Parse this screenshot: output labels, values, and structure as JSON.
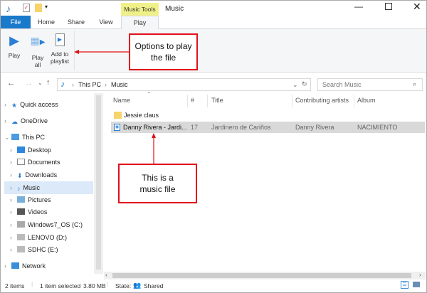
{
  "window": {
    "title": "Music",
    "context_tab_group": "Music Tools"
  },
  "tabs": [
    {
      "label": "File"
    },
    {
      "label": "Home"
    },
    {
      "label": "Share"
    },
    {
      "label": "View"
    },
    {
      "label": "Play"
    }
  ],
  "ribbon": {
    "play": "Play",
    "play_all_1": "Play",
    "play_all_2": "all",
    "add_1": "Add to",
    "add_2": "playlist"
  },
  "address": {
    "crumbs": [
      "This PC",
      "Music"
    ],
    "search_placeholder": "Search Music"
  },
  "columns": [
    "Name",
    "#",
    "Title",
    "Contributing artists",
    "Album"
  ],
  "files": [
    {
      "name": "Jessie claus",
      "num": "",
      "title": "",
      "artist": "",
      "album": "",
      "type": "folder"
    },
    {
      "name": "Danny Rivera - Jardi...",
      "num": "17",
      "title": "Jardinero de Cariños",
      "artist": "Danny Rivera",
      "album": "NACIMIENTO",
      "type": "music",
      "selected": true
    }
  ],
  "sidebar": [
    "Quick access",
    "OneDrive",
    "This PC",
    "Desktop",
    "Documents",
    "Downloads",
    "Music",
    "Pictures",
    "Videos",
    "Windows7_OS (C:)",
    "LENOVO (D:)",
    "SDHC (E:)",
    "Network"
  ],
  "status": {
    "items": "2 items",
    "selected": "1 item selected",
    "size": "3.80 MB",
    "state_label": "State:",
    "state": "Shared"
  },
  "callouts": {
    "ribbon": "Options to play the file",
    "file": "This is a music file"
  },
  "colors": {
    "file_tab": "#1979ca",
    "context": "#f0f08a",
    "callout": "#e0101a",
    "selection": "#d9d9d9"
  }
}
